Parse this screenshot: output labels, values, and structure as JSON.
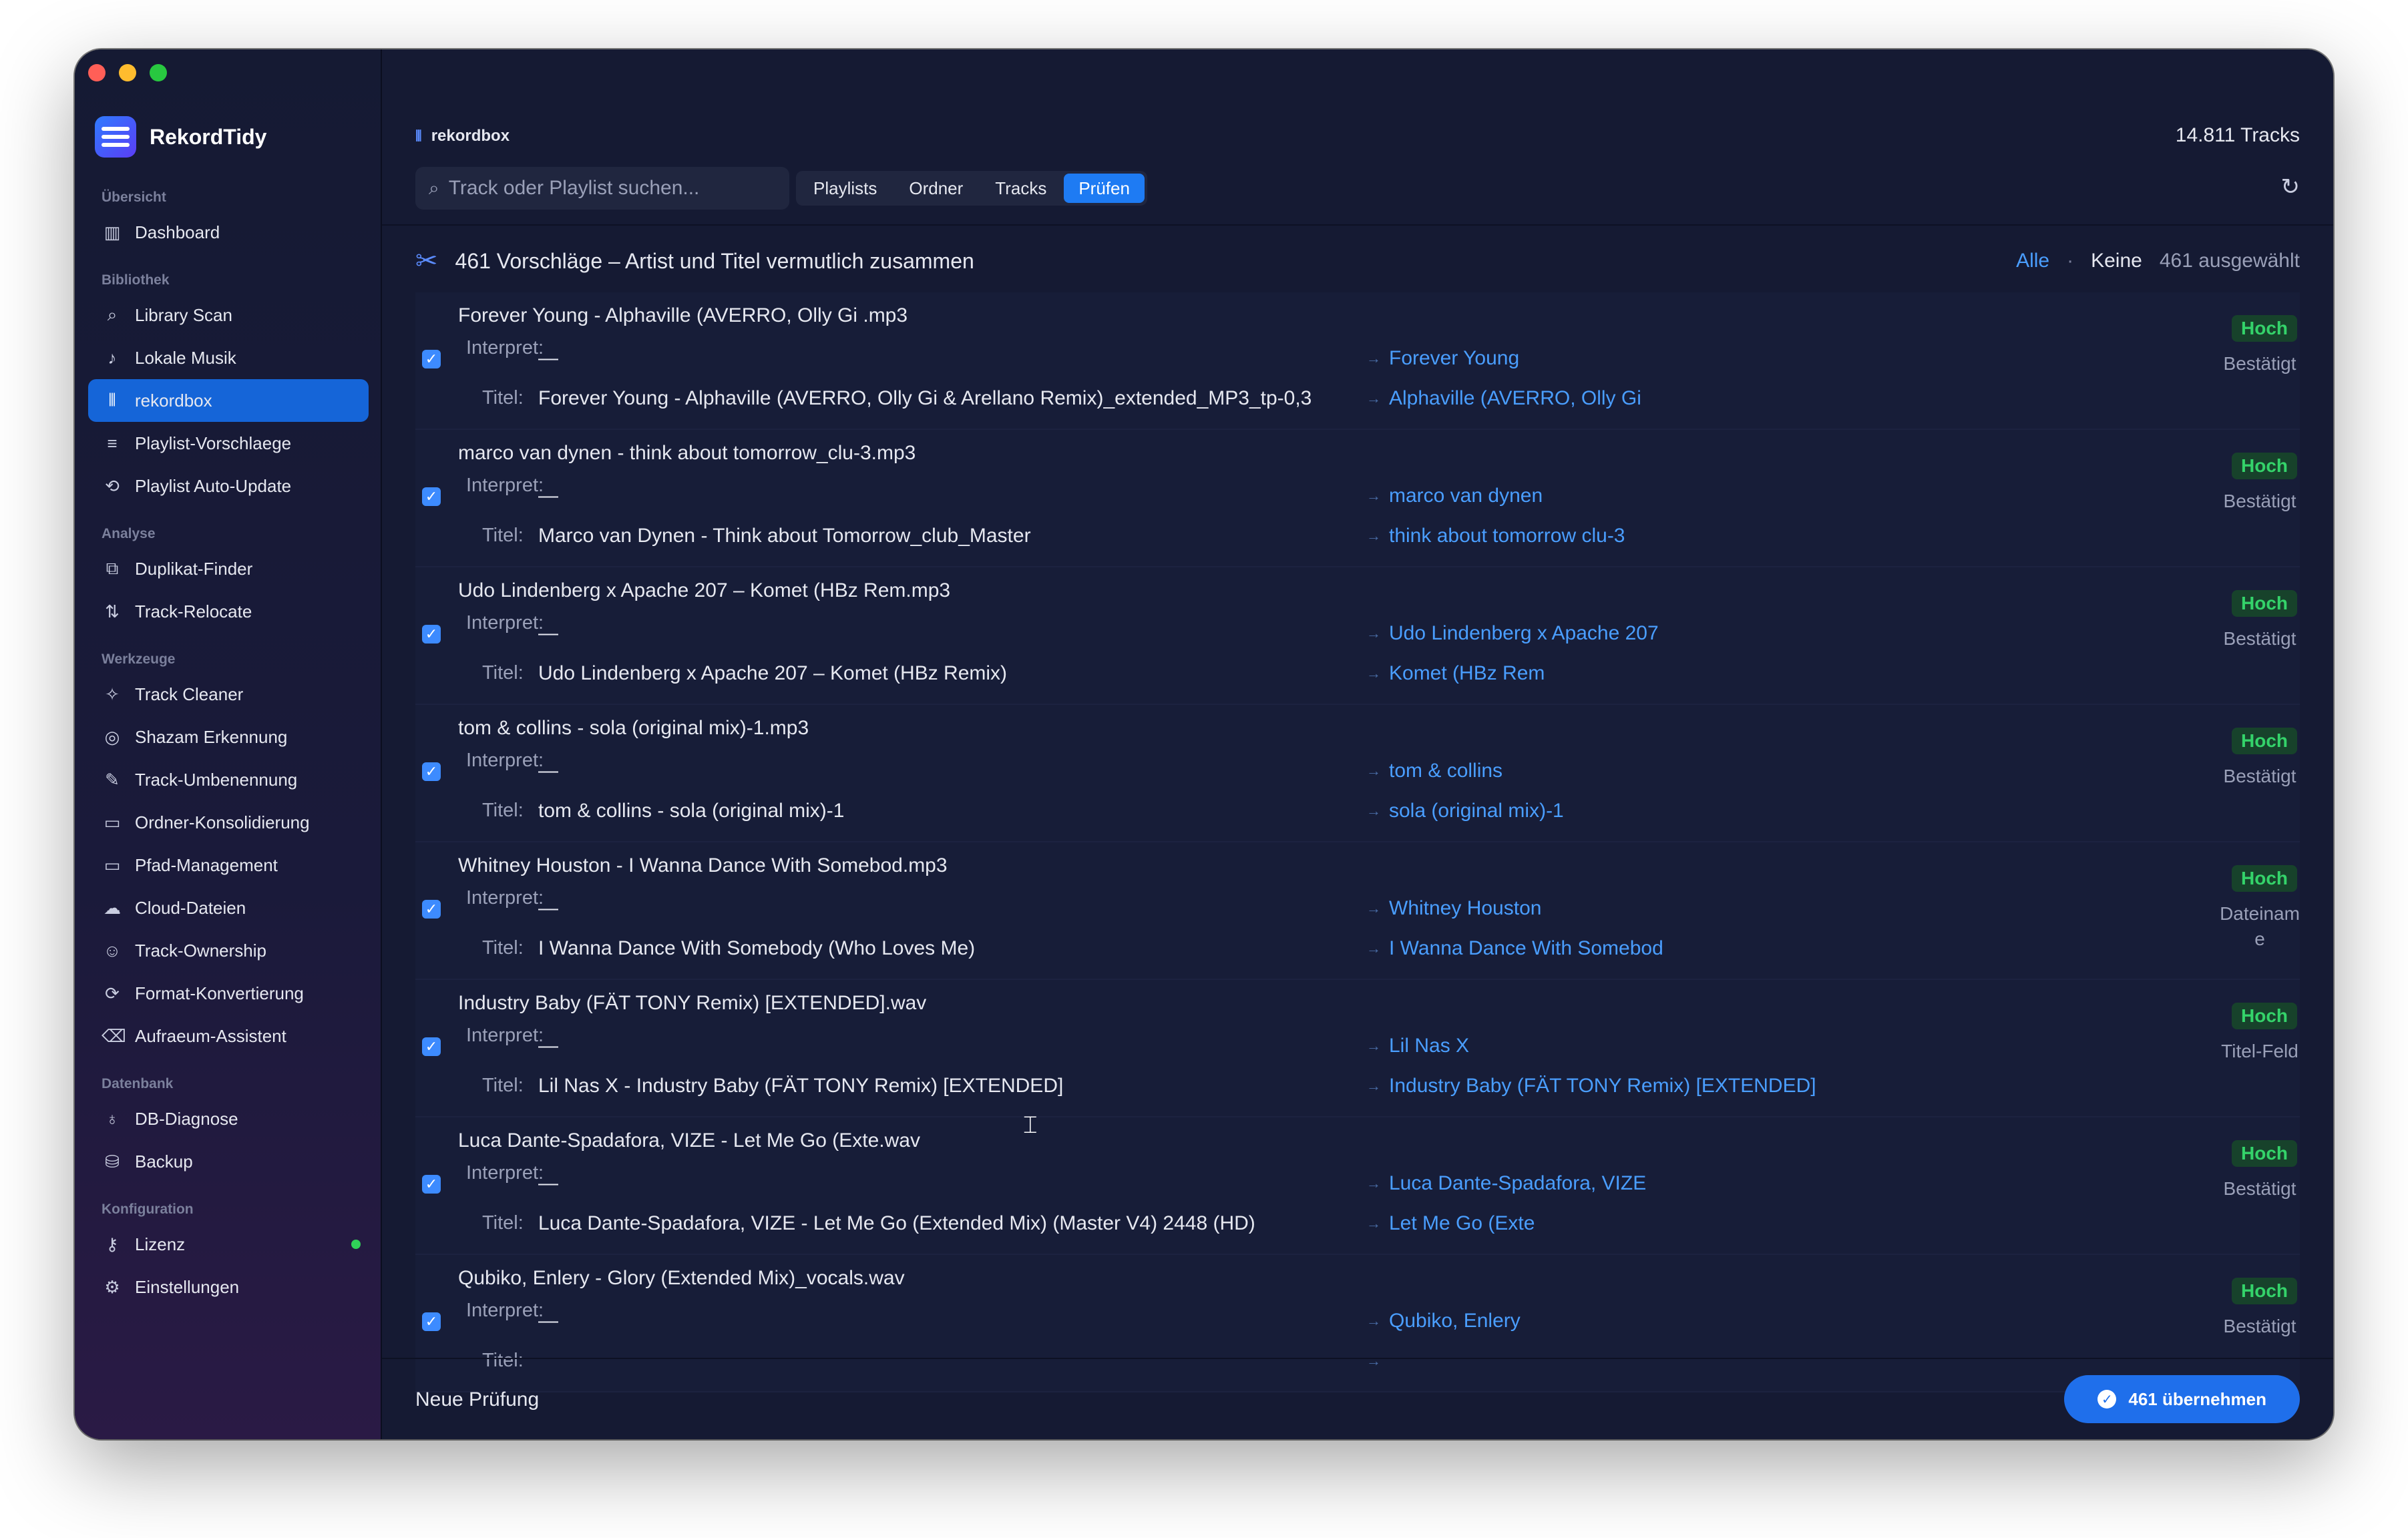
{
  "app": {
    "name": "RekordTidy"
  },
  "sidebar": {
    "sections": [
      {
        "title": "Übersicht",
        "items": [
          {
            "label": "Dashboard",
            "icon": "bar-chart-icon"
          }
        ]
      },
      {
        "title": "Bibliothek",
        "items": [
          {
            "label": "Library Scan",
            "icon": "search-icon"
          },
          {
            "label": "Lokale Musik",
            "icon": "music-note-icon"
          },
          {
            "label": "rekordbox",
            "icon": "waveform-icon",
            "active": true
          },
          {
            "label": "Playlist-Vorschlaege",
            "icon": "playlist-add-icon"
          },
          {
            "label": "Playlist Auto-Update",
            "icon": "repeat-icon"
          }
        ]
      },
      {
        "title": "Analyse",
        "items": [
          {
            "label": "Duplikat-Finder",
            "icon": "duplicate-icon"
          },
          {
            "label": "Track-Relocate",
            "icon": "relocate-icon"
          }
        ]
      },
      {
        "title": "Werkzeuge",
        "items": [
          {
            "label": "Track Cleaner",
            "icon": "magic-wand-icon"
          },
          {
            "label": "Shazam Erkennung",
            "icon": "shazam-icon"
          },
          {
            "label": "Track-Umbenennung",
            "icon": "pencil-icon"
          },
          {
            "label": "Ordner-Konsolidierung",
            "icon": "folder-icon"
          },
          {
            "label": "Pfad-Management",
            "icon": "folder-path-icon"
          },
          {
            "label": "Cloud-Dateien",
            "icon": "cloud-icon"
          },
          {
            "label": "Track-Ownership",
            "icon": "person-icon"
          },
          {
            "label": "Format-Konvertierung",
            "icon": "convert-icon"
          },
          {
            "label": "Aufraeum-Assistent",
            "icon": "trash-icon"
          }
        ]
      },
      {
        "title": "Datenbank",
        "items": [
          {
            "label": "DB-Diagnose",
            "icon": "stethoscope-icon"
          },
          {
            "label": "Backup",
            "icon": "backup-icon"
          }
        ]
      },
      {
        "title": "Konfiguration",
        "items": [
          {
            "label": "Lizenz",
            "icon": "key-icon",
            "status_dot": "#30d158"
          },
          {
            "label": "Einstellungen",
            "icon": "gear-icon"
          }
        ]
      }
    ]
  },
  "header": {
    "source": "rekordbox",
    "track_count": "14.811 Tracks",
    "search_placeholder": "Track oder Playlist suchen...",
    "tabs": [
      "Playlists",
      "Ordner",
      "Tracks",
      "Prüfen"
    ],
    "active_tab": "Prüfen"
  },
  "suggestions": {
    "title": "461 Vorschläge – Artist und Titel vermutlich zusammen",
    "all_label": "Alle",
    "separator": "·",
    "none_label": "Keine",
    "selected": "461 ausgewählt"
  },
  "labels": {
    "interpret": "Interpret:",
    "title": "Titel:",
    "empty": "—",
    "arrow": "→"
  },
  "rows": [
    {
      "file": "Forever Young - Alphaville (AVERRO, Olly Gi .mp3",
      "interpret": "—",
      "title": "Forever Young - Alphaville (AVERRO, Olly Gi & Arellano Remix)_extended_MP3_tp-0,3",
      "new_interpret": "Forever Young",
      "new_title": "Alphaville (AVERRO, Olly Gi",
      "confidence": "Hoch",
      "source": "Bestätigt"
    },
    {
      "file": "marco van dynen - think about tomorrow_clu-3.mp3",
      "interpret": "—",
      "title": "Marco van Dynen - Think about Tomorrow_club_Master",
      "new_interpret": "marco van dynen",
      "new_title": "think about tomorrow clu-3",
      "confidence": "Hoch",
      "source": "Bestätigt"
    },
    {
      "file": "Udo Lindenberg x Apache 207 – Komet (HBz Rem.mp3",
      "interpret": "—",
      "title": "Udo Lindenberg x Apache 207 – Komet (HBz Remix)",
      "new_interpret": "Udo Lindenberg x Apache 207",
      "new_title": "Komet (HBz Rem",
      "confidence": "Hoch",
      "source": "Bestätigt"
    },
    {
      "file": "tom & collins - sola (original mix)-1.mp3",
      "interpret": "—",
      "title": "tom & collins - sola (original mix)-1",
      "new_interpret": "tom & collins",
      "new_title": "sola (original mix)-1",
      "confidence": "Hoch",
      "source": "Bestätigt"
    },
    {
      "file": "Whitney Houston - I Wanna Dance With Somebod.mp3",
      "interpret": "—",
      "title": "I Wanna Dance With Somebody (Who Loves Me)",
      "new_interpret": "Whitney Houston",
      "new_title": "I Wanna Dance With Somebod",
      "confidence": "Hoch",
      "source": "Dateiname"
    },
    {
      "file": "Industry Baby (FÄT TONY Remix) [EXTENDED].wav",
      "interpret": "—",
      "title": "Lil Nas X - Industry Baby (FÄT TONY Remix) [EXTENDED]",
      "new_interpret": "Lil Nas X",
      "new_title": "Industry Baby (FÄT TONY Remix) [EXTENDED]",
      "confidence": "Hoch",
      "source": "Titel-Feld"
    },
    {
      "file": "Luca Dante-Spadafora, VIZE - Let Me Go (Exte.wav",
      "interpret": "—",
      "title": "Luca Dante-Spadafora, VIZE - Let Me Go (Extended Mix) (Master V4) 2448 (HD)",
      "new_interpret": "Luca Dante-Spadafora, VIZE",
      "new_title": "Let Me Go (Exte",
      "confidence": "Hoch",
      "source": "Bestätigt"
    },
    {
      "file": "Qubiko, Enlery - Glory (Extended Mix)_vocals.wav",
      "interpret": "—",
      "title": "",
      "new_interpret": "Qubiko, Enlery",
      "new_title": "",
      "confidence": "Hoch",
      "source": "Bestätigt"
    }
  ],
  "footer": {
    "new_check": "Neue Prüfung",
    "apply": "461 übernehmen"
  }
}
